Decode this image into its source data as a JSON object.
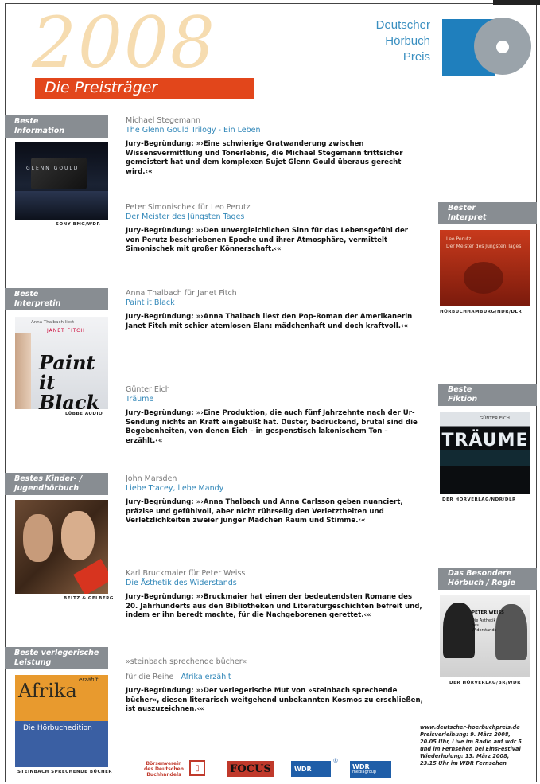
{
  "header": {
    "year": "2008",
    "subtitle": "Die Preisträger",
    "logo": {
      "line1": "Deutscher",
      "line2": "Hörbuch",
      "line3": "Preis",
      "colors": {
        "blue": "#1f7fbd",
        "disc": "#9aa3aa",
        "text": "#3a8fc0"
      }
    }
  },
  "colors": {
    "label_bg": "#888d92",
    "accent": "#e2461b",
    "title": "#2f86b8",
    "year": "#f6dcb0"
  },
  "categories": [
    {
      "line1": "Beste",
      "line2": "Information"
    },
    {
      "line1": "Bester",
      "line2": "Interpret"
    },
    {
      "line1": "Beste",
      "line2": "Interpretin"
    },
    {
      "line1": "Beste",
      "line2": "Fiktion"
    },
    {
      "line1": "Bestes Kinder- /",
      "line2": "Jugendhörbuch"
    },
    {
      "line1": "Das Besondere",
      "line2": "Hörbuch / Regie"
    },
    {
      "line1": "Beste verlegerische",
      "line2": "Leistung"
    }
  ],
  "covers": [
    {
      "caption": "GLENN GOULD",
      "publisher": "SONY BMG/WDR"
    },
    {
      "caption1": "Leo Perutz",
      "caption2": "Der Meister des Jüngsten Tages",
      "publisher": "HÖRBUCHHAMBURG/NDR/DLR"
    },
    {
      "caption1": "Anna Thalbach liest",
      "caption2": "JANET FITCH",
      "caption3": "Paint it Black",
      "publisher": "LÜBBE AUDIO"
    },
    {
      "caption1": "GÜNTER EICH",
      "caption2": "TRÄUME",
      "publisher": "DER HÖRVERLAG/NDR/DLR"
    },
    {
      "caption": "",
      "publisher": "BELTZ & GELBERG"
    },
    {
      "caption1": "PETER WEISS",
      "caption2": "Die Ästhetik des Widerstands",
      "publisher": "DER HÖRVERLAG/BR/WDR"
    },
    {
      "caption1": "Afrika",
      "caption2": "erzählt",
      "caption3": "Die Hörbuchedition",
      "publisher": "STEINBACH SPRECHENDE BÜCHER"
    }
  ],
  "entries": [
    {
      "author": "Michael Stegemann",
      "title": "The Glenn Gould Trilogy - Ein Leben",
      "text": "Jury-Begründung: »›Eine schwierige Gratwanderung zwischen Wissensvermittlung und Tonerlebnis, die Michael Stegemann trittsicher gemeistert hat und dem komplexen Sujet Glenn Gould überaus gerecht wird.‹«"
    },
    {
      "author": "Peter Simonischek für Leo Perutz",
      "title": "Der Meister des Jüngsten Tages",
      "text": "Jury-Begründung: »›Den unvergleichlichen Sinn für das Lebensgefühl der von Perutz beschriebenen Epoche und ihrer Atmosphäre, vermittelt Simonischek mit großer Könnerschaft.‹«"
    },
    {
      "author": "Anna Thalbach für Janet Fitch",
      "title": "Paint it Black",
      "text": "Jury-Begründung: »›Anna Thalbach liest den Pop-Roman der Amerikanerin Janet Fitch mit schier atemlosen Elan: mädchenhaft und doch kraftvoll.‹«"
    },
    {
      "author": "Günter Eich",
      "title": "Träume",
      "text": "Jury-Begründung: »›Eine Produktion, die auch fünf Jahrzehnte nach der Ur-Sendung nichts an Kraft eingebüßt hat. Düster, bedrückend, brutal sind die Begebenheiten, von denen Eich – in gespenstisch lakonischem Ton – erzählt.‹«"
    },
    {
      "author": "John Marsden",
      "title": "Liebe Tracey, liebe Mandy",
      "text": "Jury-Begründung: »›Anna Thalbach und Anna Carlsson geben nuanciert, präzise und gefühlvoll, aber nicht rührselig den Verletztheiten und Verletzlichkeiten zweier junger Mädchen Raum und Stimme.‹«"
    },
    {
      "author": "Karl Bruckmaier für Peter Weiss",
      "title": "Die Ästhetik des Widerstands",
      "text": "Jury-Begründung: »›Bruckmaier hat einen der bedeutendsten Romane des 20. Jahrhunderts aus den Bibliotheken und Literaturgeschichten befreit und, indem er ihn beredt machte, für die Nachgeborenen gerettet.‹«"
    },
    {
      "author": "»steinbach sprechende bücher«",
      "author2": "für die Reihe",
      "title": "Afrika erzählt",
      "text": "Jury-Begründung: »›Der verlegerische Mut von »steinbach sprechende bücher«, diesen literarisch weitgehend unbekannten Kosmos zu erschließen, ist auszuzeichnen.‹«"
    }
  ],
  "footer": {
    "url": "www.deutscher-hoerbuchpreis.de",
    "line1": "Preisverleihung: 9. März 2008,",
    "line2": "20.05 Uhr, Live im Radio auf wdr 5",
    "line3": "und im Fernsehen bei EinsFestival",
    "line4": "Wiederholung: 13. März 2008,",
    "line5": "23.15 Uhr im WDR Fernsehen"
  },
  "sponsors": {
    "s1": "Börsenverein des Deutschen Buchhandels",
    "s2": "FOCUS",
    "s3": "WDR",
    "s4": "WDR",
    "s4b": "mediagroup"
  }
}
